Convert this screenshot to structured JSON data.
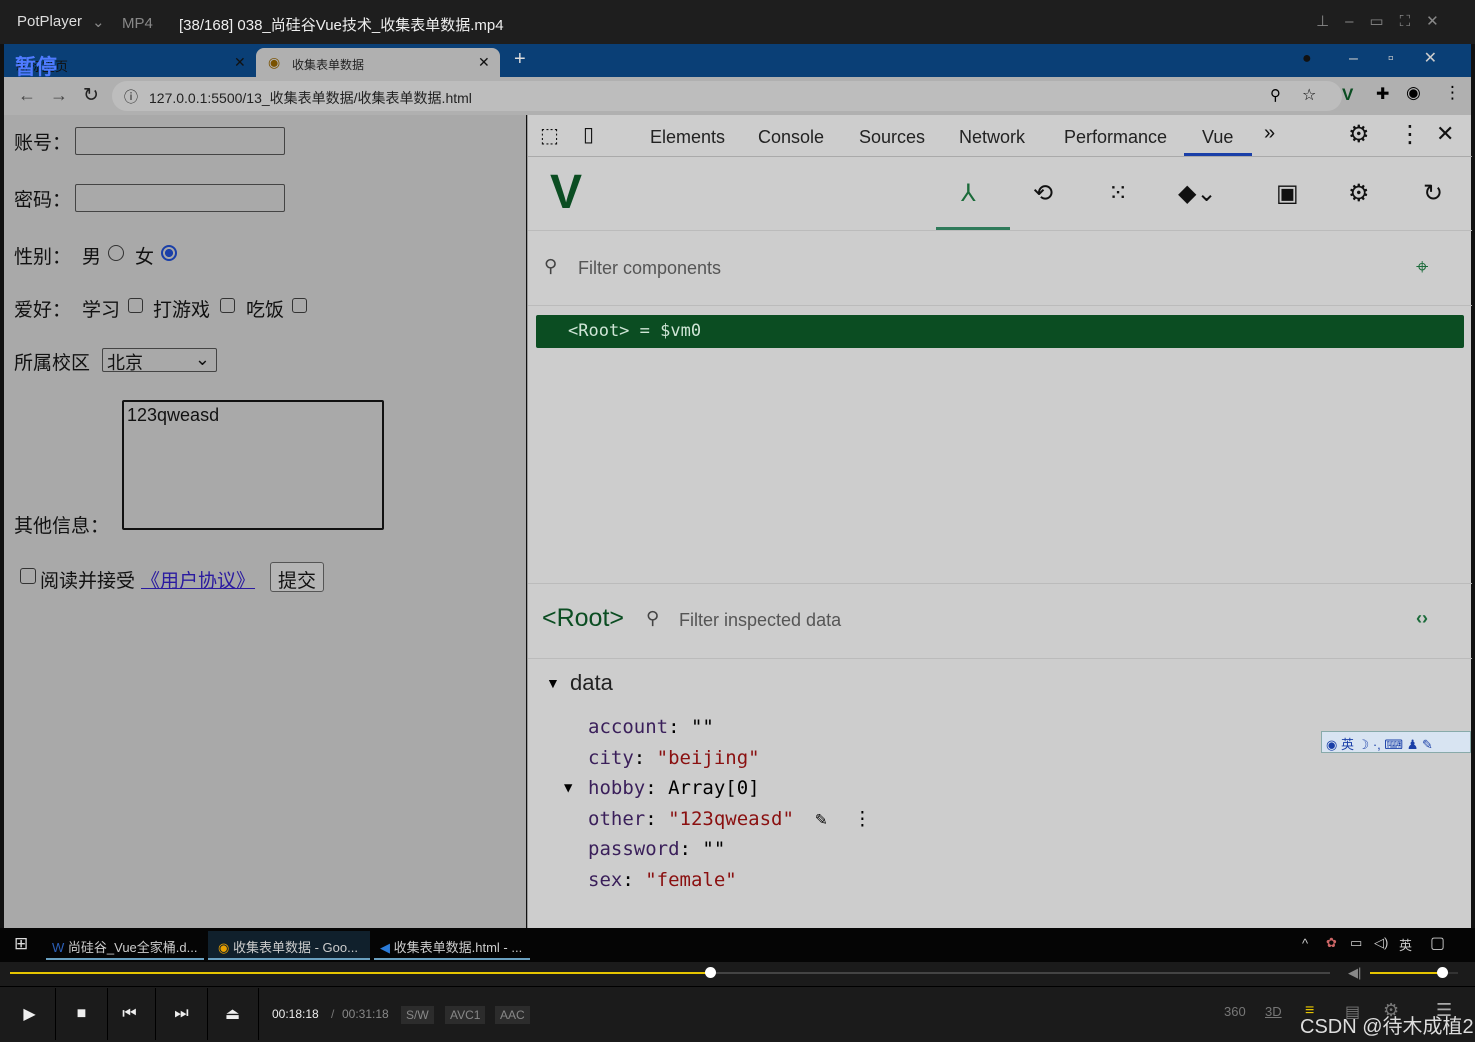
{
  "player": {
    "app": "PotPlayer",
    "format": "MP4",
    "file_title": "[38/168] 038_尚硅谷Vue技术_收集表单数据.mp4",
    "paused_label": "暂停",
    "time_current": "00:18:18",
    "time_total": "00:31:18",
    "badges": [
      "S/W",
      "AVC1",
      "AAC"
    ],
    "progress_percent": 53,
    "volume_percent": 82,
    "watermark": "CSDN @待木成植2",
    "right_icons": [
      "360",
      "3D"
    ]
  },
  "browser": {
    "tabs": [
      {
        "label": "新标签页"
      },
      {
        "label": "收集表单数据"
      }
    ],
    "url": "127.0.0.1:5500/13_收集表单数据/收集表单数据.html"
  },
  "form": {
    "account_label": "账号：",
    "account_value": "",
    "password_label": "密码：",
    "password_value": "",
    "sex_label": "性别：",
    "sex_options": [
      "男",
      "女"
    ],
    "sex_selected": "女",
    "hobby_label": "爱好：",
    "hobby_options": [
      "学习",
      "打游戏",
      "吃饭"
    ],
    "city_label": "所属校区",
    "city_value": "北京",
    "other_label": "其他信息：",
    "other_value": "123qweasd",
    "agree_text": "阅读并接受",
    "agree_link": "《用户协议》",
    "submit_label": "提交"
  },
  "devtools": {
    "tabs": [
      "Elements",
      "Console",
      "Sources",
      "Network",
      "Performance",
      "Vue"
    ],
    "active_tab": "Vue",
    "filter_components_placeholder": "Filter components",
    "root_component": "<Root>",
    "root_alias": "= $vm0",
    "inspected_title": "<Root>",
    "filter_inspected_placeholder": "Filter inspected data",
    "section": "data",
    "data": [
      {
        "key": "account",
        "value": "\"\""
      },
      {
        "key": "city",
        "value": "\"beijing\""
      },
      {
        "key": "hobby",
        "value": "Array[0]"
      },
      {
        "key": "other",
        "value": "\"123qweasd\""
      },
      {
        "key": "password",
        "value": "\"\""
      },
      {
        "key": "sex",
        "value": "\"female\""
      }
    ]
  },
  "taskbar": {
    "items": [
      "尚硅谷_Vue全家桶.d...",
      "收集表单数据 - Goo...",
      "收集表单数据.html - ..."
    ],
    "ime": "英"
  },
  "colors": {
    "vue_green": "#0b4d22",
    "accent_blue": "#1a3fa8",
    "progress_yellow": "#e5c400"
  }
}
